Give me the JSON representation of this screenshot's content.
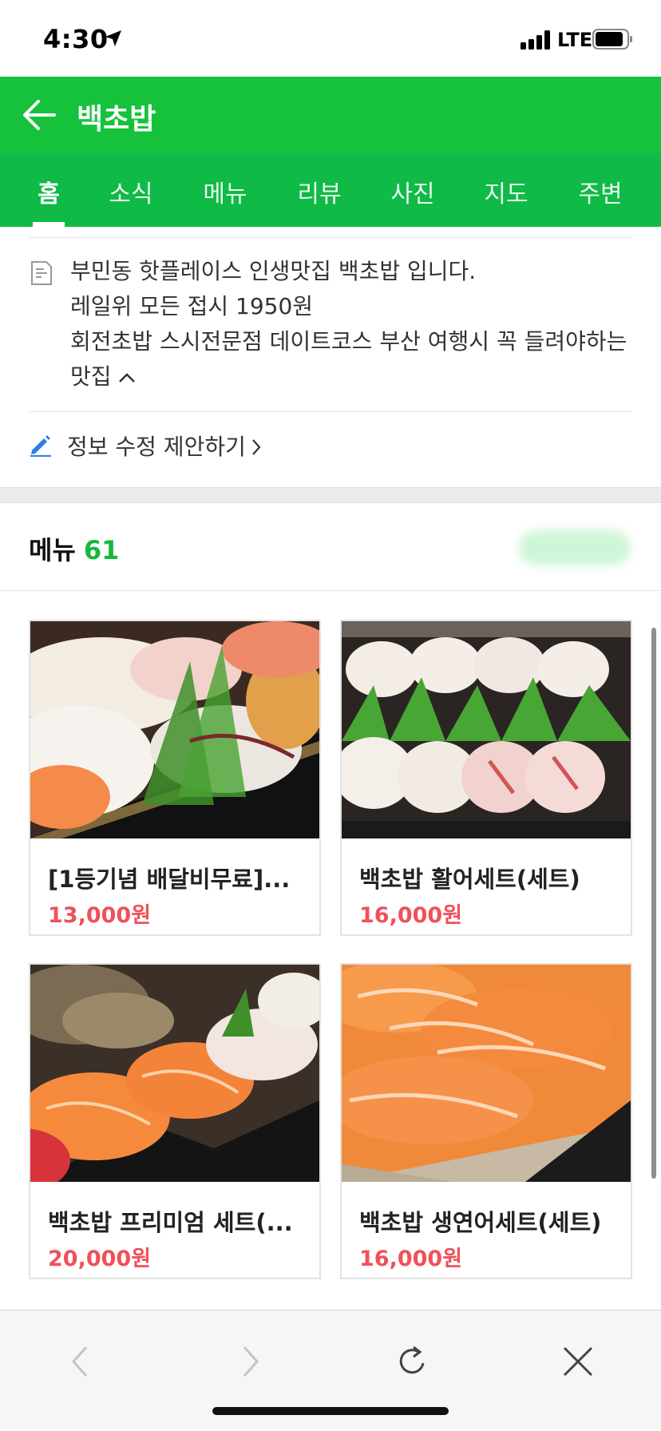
{
  "status_bar": {
    "time": "4:30",
    "network": "LTE"
  },
  "header": {
    "title": "백초밥"
  },
  "tabs": [
    {
      "label": "홈"
    },
    {
      "label": "소식"
    },
    {
      "label": "메뉴"
    },
    {
      "label": "리뷰"
    },
    {
      "label": "사진"
    },
    {
      "label": "지도"
    },
    {
      "label": "주변"
    }
  ],
  "active_tab": "홈",
  "description": {
    "lines": [
      "부민동 핫플레이스 인생맛집 백초밥 입니다.",
      "레일위 모든 접시 1950원",
      "회전초밥 스시전문점 데이트코스 부산 여행시 꼭 들려야하는",
      "맛집"
    ]
  },
  "edit_link": "정보 수정 제안하기",
  "menu": {
    "heading": "메뉴",
    "count": "61",
    "items": [
      {
        "name": "[1등기념 배달비무료]...",
        "price": "13,000원"
      },
      {
        "name": "백초밥 활어세트(세트)",
        "price": "16,000원"
      },
      {
        "name": "백초밥 프리미엄 세트(...",
        "price": "20,000원"
      },
      {
        "name": "백초밥 생연어세트(세트)",
        "price": "16,000원"
      }
    ]
  },
  "colors": {
    "brand_green": "#16c23c",
    "tab_green": "#0fba47",
    "price_red": "#f0505a"
  },
  "icons": {
    "status": [
      "location-arrow-icon",
      "signal-icon",
      "battery-icon"
    ],
    "header": [
      "back-arrow-icon"
    ],
    "toolbar": [
      "browser-back-icon",
      "browser-forward-icon",
      "reload-icon",
      "close-icon"
    ]
  }
}
